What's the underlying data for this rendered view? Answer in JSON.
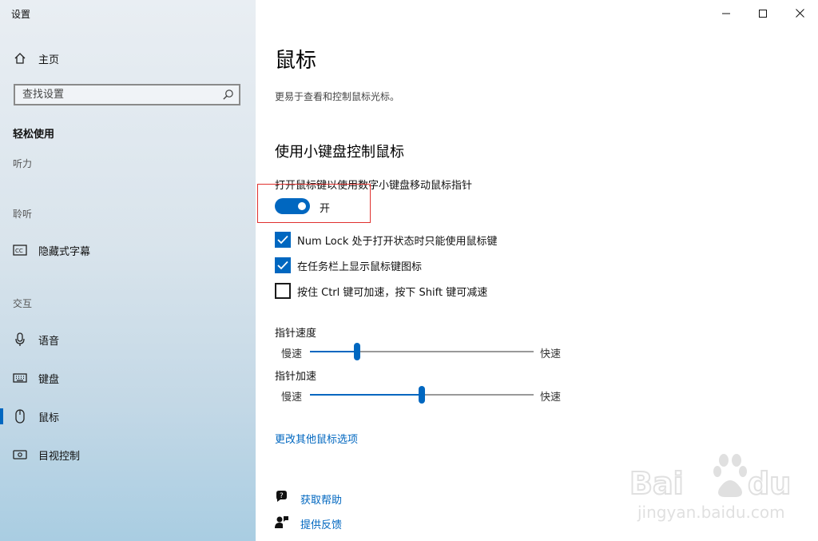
{
  "window": {
    "title": "设置",
    "controls": [
      "minimize-icon",
      "maximize-icon",
      "close-icon"
    ]
  },
  "sidebar": {
    "home_label": "主页",
    "search_placeholder": "查找设置",
    "current_section": "轻松使用",
    "categories": {
      "vision_partial": "听力",
      "hearing": "聆听",
      "interaction": "交互"
    },
    "items": [
      {
        "icon": "closed-caption-icon",
        "label": "隐藏式字幕"
      },
      {
        "icon": "microphone-icon",
        "label": "语音"
      },
      {
        "icon": "keyboard-icon",
        "label": "键盘"
      },
      {
        "icon": "mouse-icon",
        "label": "鼠标",
        "selected": true
      },
      {
        "icon": "eye-control-icon",
        "label": "目视控制"
      }
    ]
  },
  "main": {
    "title": "鼠标",
    "description": "更易于查看和控制鼠标光标。",
    "section_title": "使用小键盘控制鼠标",
    "toggle": {
      "caption": "打开鼠标键以使用数字小键盘移动鼠标指针",
      "state_label": "开",
      "on": true
    },
    "checkboxes": [
      {
        "label": "Num Lock 处于打开状态时只能使用鼠标键",
        "checked": true
      },
      {
        "label": "在任务栏上显示鼠标键图标",
        "checked": true
      },
      {
        "label": "按住 Ctrl 键可加速，按下 Shift 键可减速",
        "checked": false
      }
    ],
    "sliders": [
      {
        "title": "指针速度",
        "low_label": "慢速",
        "high_label": "快速",
        "value": 0.21
      },
      {
        "title": "指针加速",
        "low_label": "慢速",
        "high_label": "快速",
        "value": 0.5
      }
    ],
    "more_options_link": "更改其他鼠标选项",
    "help_links": [
      {
        "icon": "help-chat-icon",
        "label": "获取帮助"
      },
      {
        "icon": "feedback-icon",
        "label": "提供反馈"
      }
    ]
  },
  "watermark": {
    "brand": "Baidu经验",
    "url": "jingyan.baidu.com"
  },
  "colors": {
    "accent": "#0067c0",
    "highlight_box": "#e0312e"
  }
}
